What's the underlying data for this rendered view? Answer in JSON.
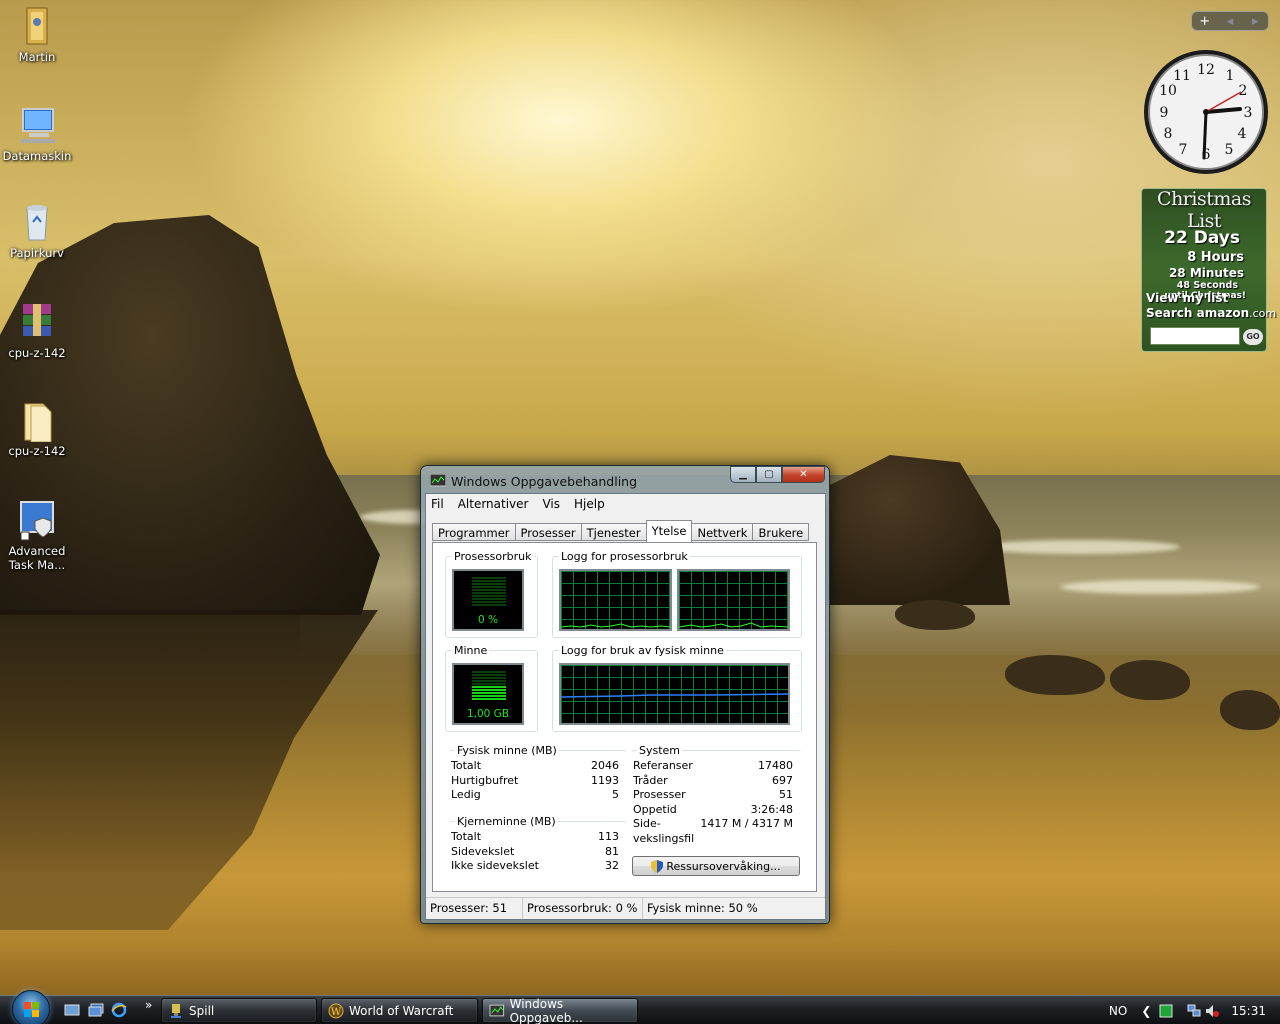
{
  "desktop": {
    "icons": [
      {
        "label": "Martin",
        "icon": "user-folder-icon"
      },
      {
        "label": "Datamaskin",
        "icon": "computer-icon"
      },
      {
        "label": "Papirkurv",
        "icon": "recycle-bin-icon"
      },
      {
        "label": "cpu-z-142",
        "icon": "winrar-archive-icon"
      },
      {
        "label": "cpu-z-142",
        "icon": "folder-icon"
      },
      {
        "label": "Advanced Task Ma...",
        "icon": "task-manager-shortcut-icon"
      }
    ]
  },
  "sidebar": {
    "controls": [
      "+",
      "◂",
      "▸"
    ],
    "xmas": {
      "title": "Christmas List",
      "days_num": "22",
      "days_label": "Days",
      "hours_num": "8",
      "hours_label": "Hours",
      "minutes_num": "28",
      "minutes_label": "Minutes",
      "seconds_num": "48",
      "seconds_label": "Seconds",
      "until": "until Christmas!",
      "view_list": "View my list",
      "search_label": "Search",
      "brand": "amazon",
      "brand_suffix": ".com",
      "go": "GO"
    }
  },
  "taskmgr": {
    "title": "Windows Oppgavebehandling",
    "menu": [
      "Fil",
      "Alternativer",
      "Vis",
      "Hjelp"
    ],
    "tabs": [
      "Programmer",
      "Prosesser",
      "Tjenester",
      "Ytelse",
      "Nettverk",
      "Brukere"
    ],
    "active_tab": "Ytelse",
    "cpu_label": "Prosessorbruk",
    "cpu_value": "0 %",
    "cpu_fraction": 0,
    "cpu_history_label": "Logg for prosessorbruk",
    "mem_label": "Minne",
    "mem_value": "1,00 GB",
    "mem_fraction": 0.5,
    "mem_history_label": "Logg for bruk av fysisk minne",
    "physical": {
      "title": "Fysisk minne (MB)",
      "rows": [
        {
          "label": "Totalt",
          "value": "2046"
        },
        {
          "label": "Hurtigbufret",
          "value": "1193"
        },
        {
          "label": "Ledig",
          "value": "5"
        }
      ]
    },
    "kernel": {
      "title": "Kjerneminne (MB)",
      "rows": [
        {
          "label": "Totalt",
          "value": "113"
        },
        {
          "label": "Sidevekslet",
          "value": "81"
        },
        {
          "label": "Ikke sidevekslet",
          "value": "32"
        }
      ]
    },
    "system": {
      "title": "System",
      "rows": [
        {
          "label": "Referanser",
          "value": "17480"
        },
        {
          "label": "Tråder",
          "value": "697"
        },
        {
          "label": "Prosesser",
          "value": "51"
        },
        {
          "label": "Oppetid",
          "value": "3:26:48"
        },
        {
          "label": "Side-",
          "value": "1417 M / 4317 M"
        },
        {
          "label": "vekslingsfil",
          "value": ""
        }
      ]
    },
    "resource_button": "Ressursovervåking...",
    "status": {
      "processes": "Prosesser: 51",
      "cpu": "Prosessorbruk: 0 %",
      "memory": "Fysisk minne: 50 %"
    }
  },
  "taskbar": {
    "chevron": "»",
    "buttons": [
      {
        "label": "Spill"
      },
      {
        "label": "World of Warcraft"
      },
      {
        "label": "Windows Oppgaveb..."
      }
    ],
    "tray": {
      "lang": "NO",
      "time": "15:31"
    }
  },
  "colors": {
    "meter_green": "#21e221",
    "grid_green": "#0b7d3a",
    "mem_line": "#2a7fff"
  }
}
